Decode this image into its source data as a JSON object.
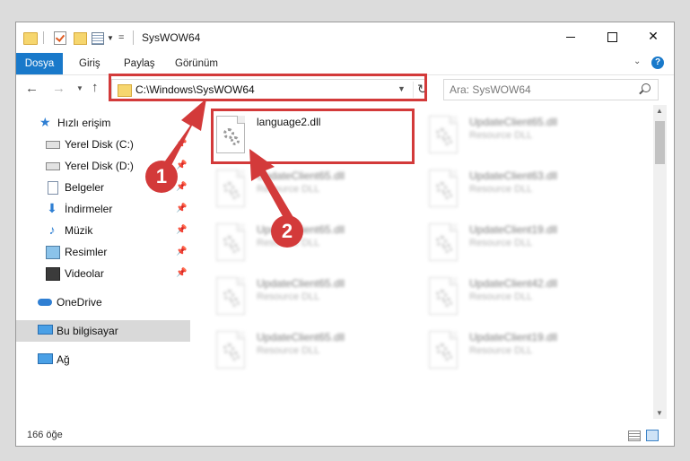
{
  "window": {
    "title": "SysWOW64"
  },
  "ribbon": {
    "tabs": [
      "Dosya",
      "Giriş",
      "Paylaş",
      "Görünüm"
    ],
    "help_label": "?"
  },
  "nav": {
    "address_path": "C:\\Windows\\SysWOW64",
    "search_placeholder": "Ara: SysWOW64"
  },
  "sidebar": {
    "items": [
      {
        "label": "Hızlı erişim",
        "icon": "star-icon"
      },
      {
        "label": "Yerel Disk (C:)",
        "icon": "drive-icon",
        "pinned": true
      },
      {
        "label": "Yerel Disk (D:)",
        "icon": "drive-icon",
        "pinned": true
      },
      {
        "label": "Belgeler",
        "icon": "documents-icon",
        "pinned": true
      },
      {
        "label": "İndirmeler",
        "icon": "download-icon",
        "pinned": true
      },
      {
        "label": "Müzik",
        "icon": "music-icon",
        "pinned": true
      },
      {
        "label": "Resimler",
        "icon": "pictures-icon",
        "pinned": true
      },
      {
        "label": "Videolar",
        "icon": "videos-icon",
        "pinned": true
      },
      {
        "label": "OneDrive",
        "icon": "cloud-icon"
      },
      {
        "label": "Bu bilgisayar",
        "icon": "computer-icon",
        "selected": true
      },
      {
        "label": "Ağ",
        "icon": "network-icon"
      }
    ]
  },
  "files": [
    {
      "name": "language2.dll",
      "type": ""
    },
    {
      "name": "UpdateClient65.dll",
      "type": "Resource DLL"
    },
    {
      "name": "UpdateClient65.dll",
      "type": "Resource DLL"
    },
    {
      "name": "UpdateClient63.dll",
      "type": "Resource DLL"
    },
    {
      "name": "UpdateClient65.dll",
      "type": "Resource DLL"
    },
    {
      "name": "UpdateClient19.dll",
      "type": "Resource DLL"
    },
    {
      "name": "UpdateClient65.dll",
      "type": "Resource DLL"
    },
    {
      "name": "UpdateClient42.dll",
      "type": "Resource DLL"
    },
    {
      "name": "UpdateClient65.dll",
      "type": "Resource DLL"
    },
    {
      "name": "UpdateClient19.dll",
      "type": "Resource DLL"
    }
  ],
  "status": {
    "item_count": "166 öğe"
  },
  "annotations": {
    "step1": "1",
    "step2": "2",
    "color": "#d33a3a"
  }
}
